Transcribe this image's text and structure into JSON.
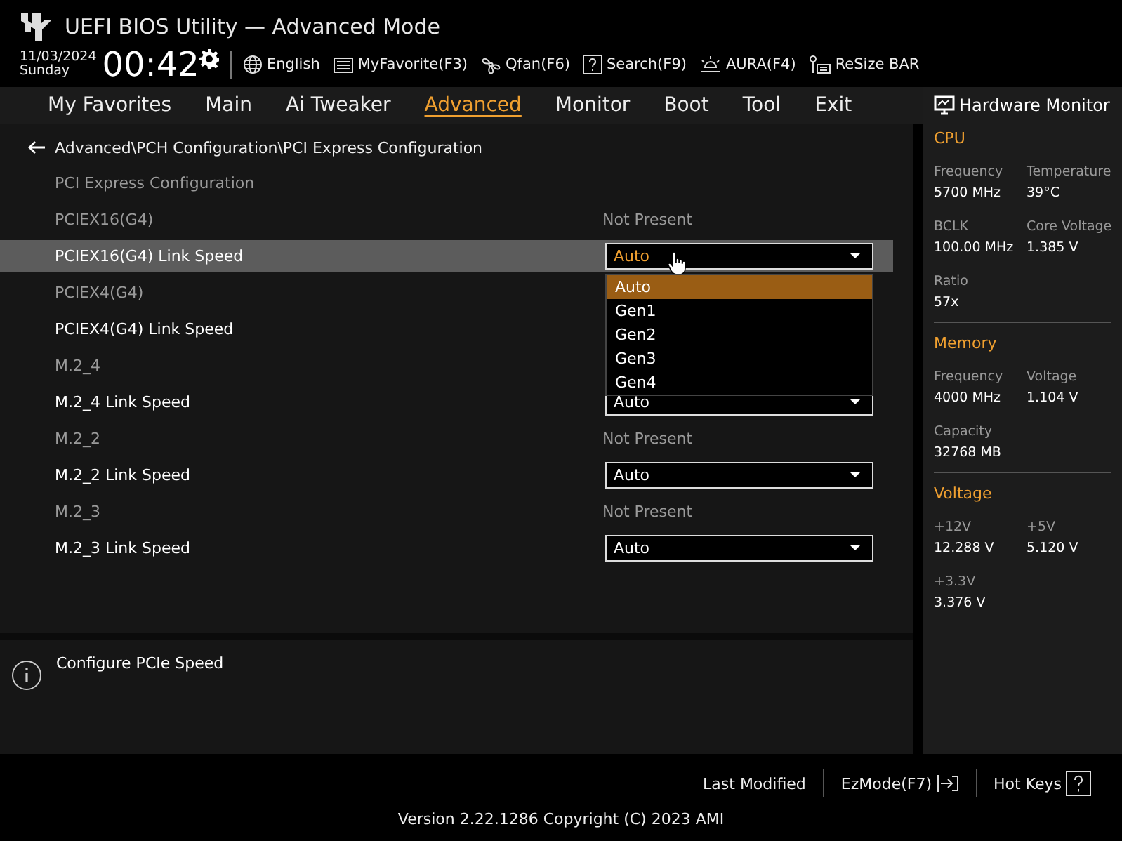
{
  "header": {
    "title": "UEFI BIOS Utility — Advanced Mode",
    "date": "11/03/2024",
    "day": "Sunday",
    "time": "00:42",
    "tools": [
      {
        "kind": "globe",
        "label": "English"
      },
      {
        "kind": "favorite",
        "label": "MyFavorite(F3)"
      },
      {
        "kind": "fan",
        "label": "Qfan(F6)"
      },
      {
        "kind": "search",
        "label": "Search(F9)"
      },
      {
        "kind": "aura",
        "label": "AURA(F4)"
      },
      {
        "kind": "resize",
        "label": "ReSize BAR"
      }
    ]
  },
  "tabs": [
    {
      "label": "My Favorites",
      "selected": false
    },
    {
      "label": "Main",
      "selected": false
    },
    {
      "label": "Ai Tweaker",
      "selected": false
    },
    {
      "label": "Advanced",
      "selected": true
    },
    {
      "label": "Monitor",
      "selected": false
    },
    {
      "label": "Boot",
      "selected": false
    },
    {
      "label": "Tool",
      "selected": false
    },
    {
      "label": "Exit",
      "selected": false
    }
  ],
  "breadcrumb": "Advanced\\PCH Configuration\\PCI Express Configuration",
  "rows": [
    {
      "kind": "heading",
      "label": "PCI Express Configuration",
      "selected": false
    },
    {
      "kind": "info",
      "label": "PCIEX16(G4)",
      "value": "Not Present",
      "selected": false
    },
    {
      "kind": "select",
      "label": "PCIEX16(G4) Link Speed",
      "value": "Auto",
      "selected": true,
      "options": [
        {
          "label": "Auto",
          "selected": true
        },
        {
          "label": "Gen1",
          "selected": false
        },
        {
          "label": "Gen2",
          "selected": false
        },
        {
          "label": "Gen3",
          "selected": false
        },
        {
          "label": "Gen4",
          "selected": false
        }
      ]
    },
    {
      "kind": "info",
      "label": "PCIEX4(G4)",
      "selected": false
    },
    {
      "kind": "select",
      "label": "PCIEX4(G4) Link Speed",
      "selected": false
    },
    {
      "kind": "info",
      "label": "M.2_4",
      "selected": false
    },
    {
      "kind": "select",
      "label": "M.2_4 Link Speed",
      "value": "Auto",
      "selected": false
    },
    {
      "kind": "info",
      "label": "M.2_2",
      "value": "Not Present",
      "selected": false
    },
    {
      "kind": "select",
      "label": "M.2_2 Link Speed",
      "value": "Auto",
      "selected": false
    },
    {
      "kind": "info",
      "label": "M.2_3",
      "value": "Not Present",
      "selected": false
    },
    {
      "kind": "select",
      "label": "M.2_3 Link Speed",
      "value": "Auto",
      "selected": false
    }
  ],
  "help": "Configure PCIe Speed",
  "hardware_monitor": {
    "title": "Hardware Monitor",
    "sections": [
      {
        "title": "CPU",
        "items": [
          {
            "label": "Frequency",
            "value": "5700 MHz"
          },
          {
            "label": "Temperature",
            "value": "39°C"
          },
          {
            "label": "BCLK",
            "value": "100.00 MHz"
          },
          {
            "label": "Core Voltage",
            "value": "1.385 V"
          },
          {
            "label": "Ratio",
            "value": "57x"
          }
        ]
      },
      {
        "title": "Memory",
        "items": [
          {
            "label": "Frequency",
            "value": "4000 MHz"
          },
          {
            "label": "Voltage",
            "value": "1.104 V"
          },
          {
            "label": "Capacity",
            "value": "32768 MB"
          }
        ]
      },
      {
        "title": "Voltage",
        "items": [
          {
            "label": "+12V",
            "value": "12.288 V"
          },
          {
            "label": "+5V",
            "value": "5.120 V"
          },
          {
            "label": "+3.3V",
            "value": "3.376 V"
          }
        ]
      }
    ]
  },
  "footer": {
    "buttons": [
      {
        "kind": "plain",
        "label": "Last Modified"
      },
      {
        "kind": "exit",
        "label": "EzMode(F7)"
      },
      {
        "kind": "help",
        "label": "Hot Keys"
      }
    ],
    "version": "Version 2.22.1286 Copyright (C) 2023 AMI"
  }
}
